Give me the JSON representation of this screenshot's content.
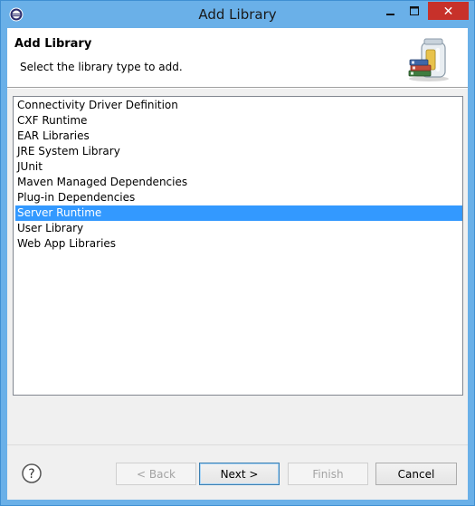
{
  "window": {
    "title": "Add Library",
    "close_glyph": "✕"
  },
  "banner": {
    "title": "Add Library",
    "description": "Select the library type to add.",
    "art_icon": "library-jar-icon"
  },
  "library_types": [
    {
      "label": "Connectivity Driver Definition",
      "selected": false
    },
    {
      "label": "CXF Runtime",
      "selected": false
    },
    {
      "label": "EAR Libraries",
      "selected": false
    },
    {
      "label": "JRE System Library",
      "selected": false
    },
    {
      "label": "JUnit",
      "selected": false
    },
    {
      "label": "Maven Managed Dependencies",
      "selected": false
    },
    {
      "label": "Plug-in Dependencies",
      "selected": false
    },
    {
      "label": "Server Runtime",
      "selected": true
    },
    {
      "label": "User Library",
      "selected": false
    },
    {
      "label": "Web App Libraries",
      "selected": false
    }
  ],
  "buttons": {
    "back": "< Back",
    "next": "Next >",
    "finish": "Finish",
    "cancel": "Cancel"
  },
  "colors": {
    "titlebar": "#6ab0e8",
    "close": "#c7312a",
    "selection": "#3399ff"
  }
}
